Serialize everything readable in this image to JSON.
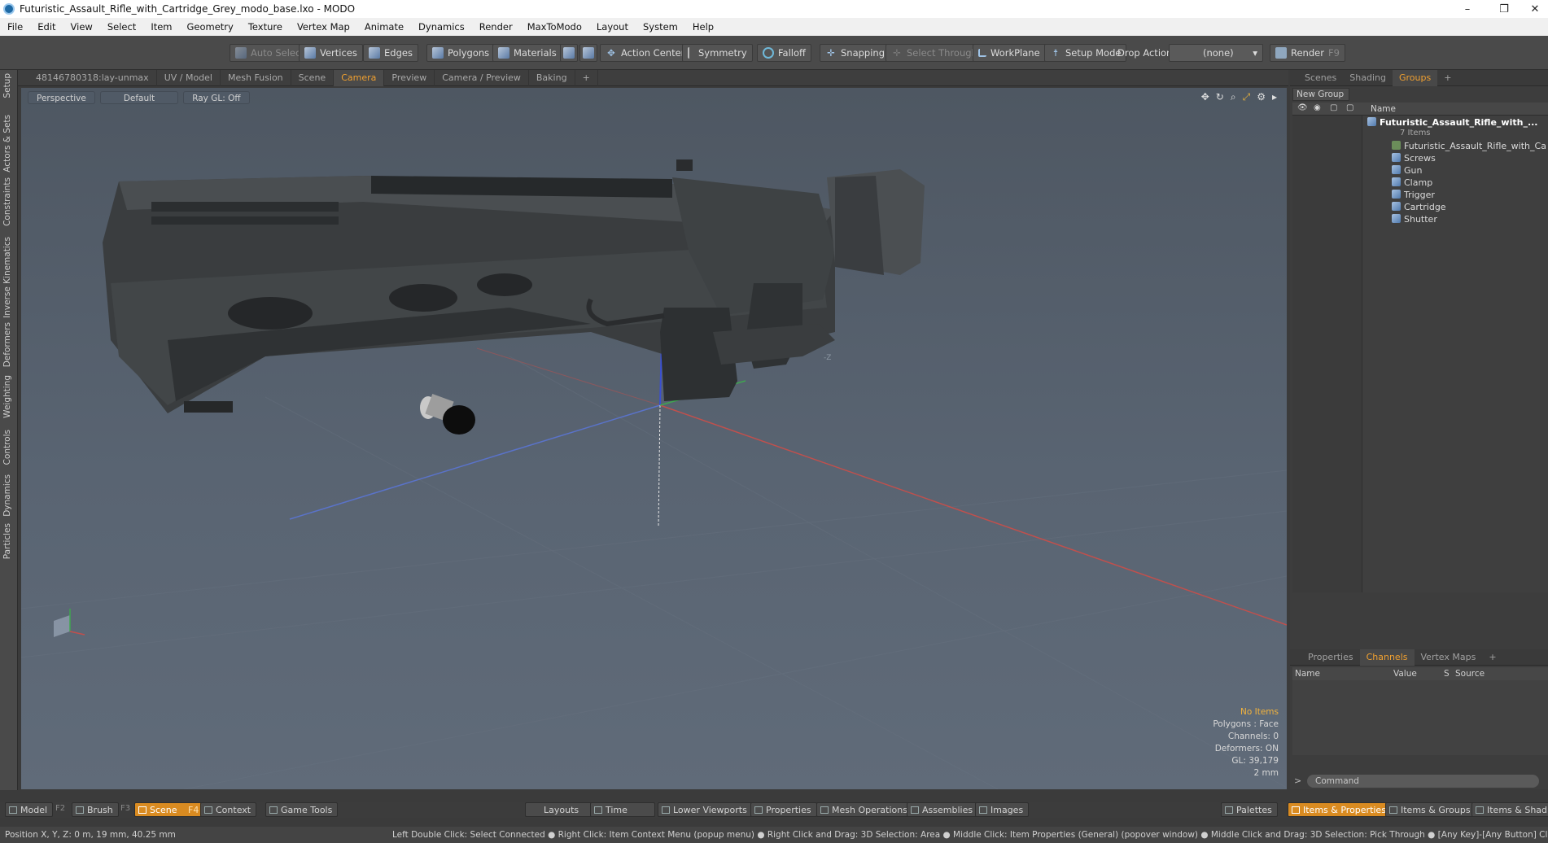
{
  "window": {
    "title": "Futuristic_Assault_Rifle_with_Cartridge_Grey_modo_base.lxo - MODO"
  },
  "menu": [
    "File",
    "Edit",
    "View",
    "Select",
    "Item",
    "Geometry",
    "Texture",
    "Vertex Map",
    "Animate",
    "Dynamics",
    "Render",
    "MaxToModo",
    "Layout",
    "System",
    "Help"
  ],
  "toolbar": {
    "auto_select": "Auto Select",
    "vertices": "Vertices",
    "edges": "Edges",
    "polygons": "Polygons",
    "materials": "Materials",
    "action_center": "Action Center",
    "symmetry": "Symmetry",
    "falloff": "Falloff",
    "snapping": "Snapping",
    "select_through": "Select Through",
    "workplane": "WorkPlane",
    "setup_mode": "Setup Mode",
    "drop_action_label": "Drop Action",
    "drop_action_value": "(none)",
    "render": "Render",
    "render_key": "F9"
  },
  "left_tabs": [
    "Setup",
    "Actors & Sets",
    "Constraints",
    "Inverse Kinematics",
    "Deformers",
    "Weighting",
    "Controls",
    "Dynamics",
    "Particles"
  ],
  "viewport_tabs": [
    "48146780318:lay-unmax",
    "UV / Model",
    "Mesh Fusion",
    "Scene",
    "Camera",
    "Preview",
    "Camera / Preview",
    "Baking",
    "+"
  ],
  "viewport_active_tab": "Camera",
  "viewport": {
    "view_mode": "Perspective",
    "shading": "Default",
    "raygl": "Ray GL: Off",
    "info": {
      "selection": "No Items",
      "polygons": "Polygons : Face",
      "channels": "Channels: 0",
      "deformers": "Deformers: ON",
      "gl": "GL: 39,179",
      "grid": "2 mm"
    },
    "axis_z": "-Z"
  },
  "right_top_tabs": [
    "Scenes",
    "Shading",
    "Groups",
    "+"
  ],
  "right_top_active": "Groups",
  "groups": {
    "new_group": "New Group",
    "name_col": "Name",
    "root": "Futuristic_Assault_Rifle_with_...",
    "root_count": "7 Items",
    "children": [
      "Futuristic_Assault_Rifle_with_Car...",
      "Screws",
      "Gun",
      "Clamp",
      "Trigger",
      "Cartridge",
      "Shutter"
    ]
  },
  "right_bottom_tabs": [
    "Properties",
    "Channels",
    "Vertex Maps",
    "+"
  ],
  "right_bottom_active": "Channels",
  "channels": {
    "name": "Name",
    "value": "Value",
    "s": "S",
    "source": "Source"
  },
  "command": {
    "prompt": ">",
    "placeholder": "Command"
  },
  "bottom_tabs": {
    "model": "Model",
    "model_key": "F2",
    "brush": "Brush",
    "brush_key": "F3",
    "scene": "Scene",
    "scene_key": "F4",
    "context": "Context",
    "game_tools": "Game Tools",
    "layouts": "Layouts",
    "time": "Time",
    "lower_viewports": "Lower Viewports",
    "properties": "Properties",
    "mesh_operations": "Mesh Operations",
    "assemblies": "Assemblies",
    "images": "Images",
    "palettes": "Palettes",
    "items_properties": "Items & Properties",
    "items_groups": "Items & Groups",
    "items_shading": "Items & Shadin"
  },
  "status": {
    "position": "Position X, Y, Z:   0 m, 19 mm, 40.25 mm",
    "hints": "Left Double Click: Select Connected ● Right Click: Item Context Menu (popup menu) ● Right Click and Drag: 3D Selection: Area ● Middle Click: Item Properties (General) (popover window) ● Middle Click and Drag: 3D Selection: Pick Through ● [Any Key]-[Any Button] Click and Drag: dragDrop"
  }
}
